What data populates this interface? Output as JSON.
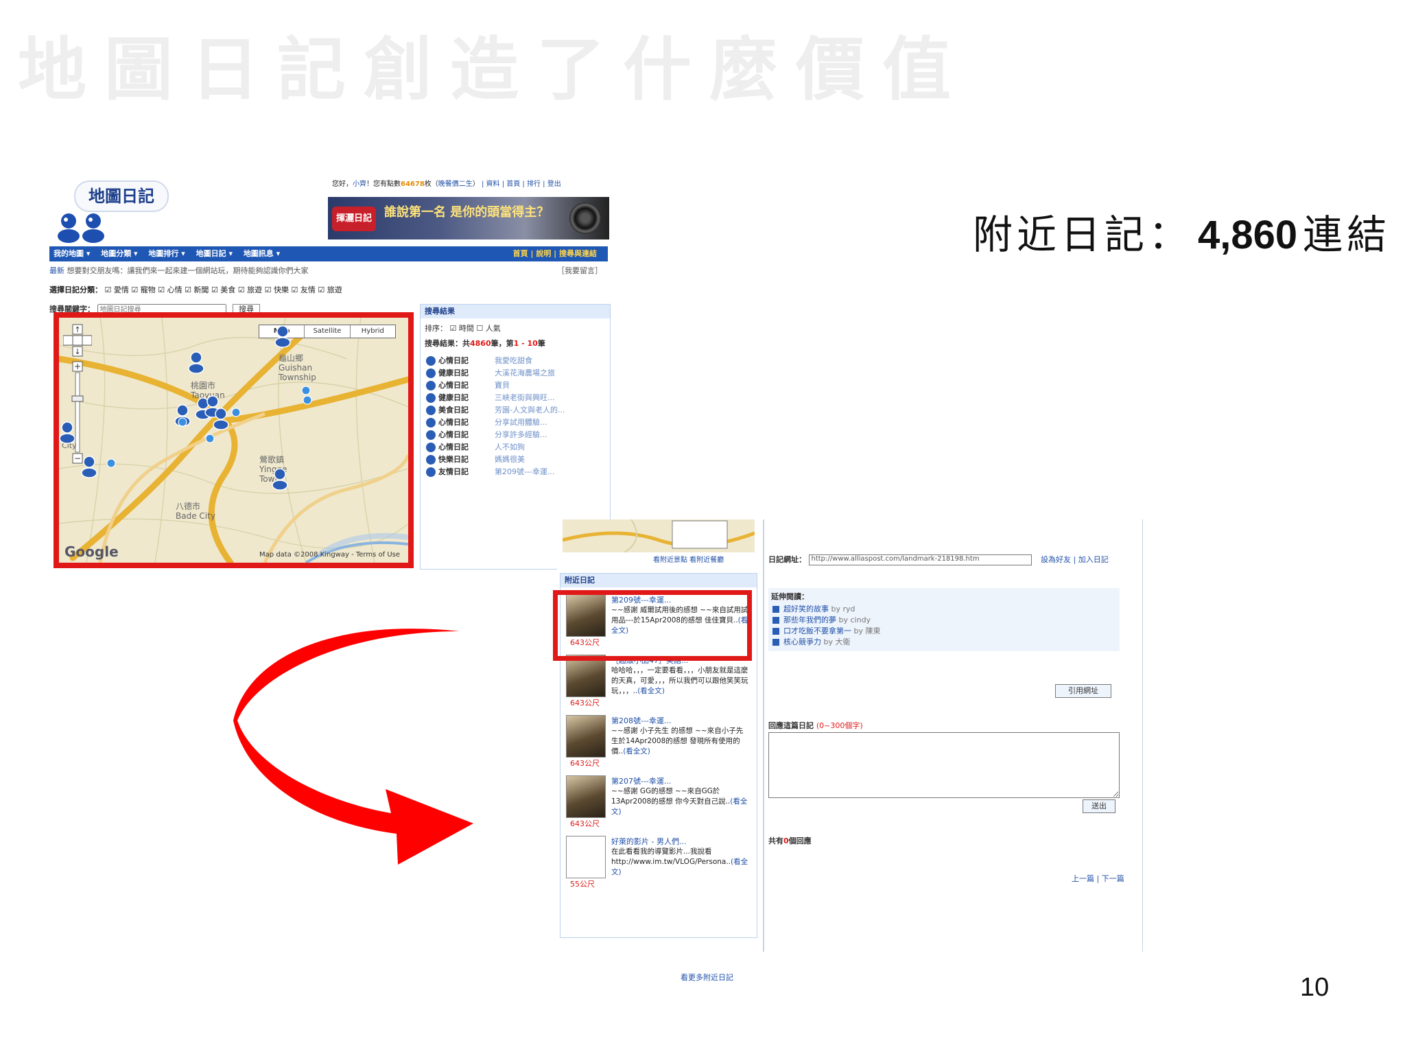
{
  "slide": {
    "title": "地圖日記創造了什麼價值",
    "callout_label": "附近日記：",
    "callout_number": "4,860",
    "callout_unit": "連結",
    "page_number": "10"
  },
  "shot1": {
    "logo": "地圖日記",
    "greeting": {
      "hello": "您好，",
      "user": "小齊",
      "mid": "！您有點數",
      "points": "64678",
      "unit": "枚（",
      "link1": "晚餐價二生",
      "after": "）",
      "links": "| 資料 | 首頁 | 排行 | 登出"
    },
    "banner": {
      "badge": "揮灑日記",
      "text": "誰說第一名  是你的頭當得主？"
    },
    "nav": {
      "items": [
        "我的地圖 ▾",
        "地圖分類 ▾",
        "地圖排行 ▾",
        "地圖日記 ▾",
        "地圖訊息 ▾"
      ],
      "right": "首頁 | 說明 | 搜尋與連結"
    },
    "notice": {
      "tag": "最新",
      "text": "想要對交朋友嗎：讓我們來一起來建一個網站玩，期待能夠認識你們大家",
      "right": "［我要留言］"
    },
    "categories": {
      "label": "選擇日記分類：",
      "items": [
        "☑ 愛情",
        "☑ 寵物",
        "☑ 心情",
        "☑ 新聞",
        "☑ 美食",
        "☑ 旅遊",
        "☑ 快樂",
        "☑ 友情",
        "☑ 旅遊"
      ]
    },
    "search": {
      "label": "搜尋關鍵字：",
      "placeholder": "地圖日記搜尋",
      "button": "搜尋"
    },
    "map": {
      "types": [
        "Map",
        "Satellite",
        "Hybrid"
      ],
      "places": [
        "龜山鄉",
        "Guishan",
        "Township",
        "桃園市",
        "Taoyuan",
        "鶯歌鎮",
        "Yingge",
        "Town",
        "八德市",
        "Bade City",
        "City"
      ],
      "copyright": "Map data ©2008 Kingway - Terms of Use",
      "brand": "Google"
    },
    "results": {
      "header": "搜尋結果",
      "sort": "排序：  ☑ 時間    ☐ 人氣",
      "count_pre": "搜尋結果：共",
      "count_num": "4860",
      "count_mid": "筆，第",
      "count_range": "1 - 10",
      "count_post": "筆",
      "items": [
        {
          "cat": "心情日記",
          "title": "我愛吃甜食"
        },
        {
          "cat": "健康日記",
          "title": "大溪花海農場之旅"
        },
        {
          "cat": "心情日記",
          "title": "寶貝"
        },
        {
          "cat": "健康日記",
          "title": "三峽老街與興旺..."
        },
        {
          "cat": "美食日記",
          "title": "芳園-人文與老人的..."
        },
        {
          "cat": "心情日記",
          "title": "分享試用體驗..."
        },
        {
          "cat": "心情日記",
          "title": "分享許多經驗..."
        },
        {
          "cat": "心情日記",
          "title": "人不如狗"
        },
        {
          "cat": "快樂日記",
          "title": "媽媽很美"
        },
        {
          "cat": "友情日記",
          "title": "第209號---幸運..."
        }
      ]
    }
  },
  "shot2": {
    "mini_links": "看附近景點  看附近餐廳",
    "nearby_header": "附近日記",
    "nearby": [
      {
        "title": "第209號---幸運...",
        "body": "~~感謝 威爾試用後的感想 ~~來自試用試用品---於15Apr2008的感想 佳佳寶貝..",
        "more": "(看全文)",
        "dist": "643公尺"
      },
      {
        "title": "［超級小品47］笑話...",
        "body": "哈哈哈，，，一定要看看，，，小朋友就是這麼的天真，可愛，，，所以我們可以跟他笑笑玩玩，，，..",
        "more": "(看全文)",
        "dist": "643公尺"
      },
      {
        "title": "第208號---幸運...",
        "body": "~~感謝 小子先生 的感想 ~~來自小子先生於14Apr2008的感想 發現所有使用的價..",
        "more": "(看全文)",
        "dist": "643公尺"
      },
      {
        "title": "第207號---幸運...",
        "body": "~~感謝 GG的感想 ~~來自GG於13Apr2008的感想 你今天對自己說..",
        "more": "(看全文)",
        "dist": "643公尺"
      },
      {
        "title": "好萊的影片 - 男人們...",
        "body": "在此看看我的導覽影片...我說看 http://www.im.tw/VLOG/Persona..",
        "more": "(看全文)",
        "dist": "55公尺"
      }
    ],
    "more_nearby": "看更多附近日記",
    "url_label": "日記網址：",
    "url_value": "http://www.alliaspost.com/landmark-218198.htm",
    "url_links": "設為好友 | 加入日記",
    "cat_title": "延伸閱讀：",
    "cat_lines": [
      {
        "text": "超好笑的故事",
        "by": "by ryd"
      },
      {
        "text": "那些年我們的夢",
        "by": "by cindy"
      },
      {
        "text": "口才吃飯不要拿第一",
        "by": "by 陳東"
      },
      {
        "text": "核心競爭力",
        "by": "by 大衛"
      }
    ],
    "cite_button": "引用網址",
    "reply_label": "回應這篇日記",
    "reply_limit": "(0~300個字)",
    "send_button": "送出",
    "reply_count_pre": "共有",
    "reply_count_num": "0",
    "reply_count_post": "個回應",
    "pager": "上一篇 | 下一篇"
  },
  "colors": {
    "highlight": "#e11818",
    "nav": "#1f57b4",
    "link": "#1f4fa8",
    "title_gray": "#eeeeee"
  },
  "icons": [
    "person-marker-icon",
    "map-pin-icon",
    "curved-arrow-icon",
    "speaker-icon"
  ]
}
